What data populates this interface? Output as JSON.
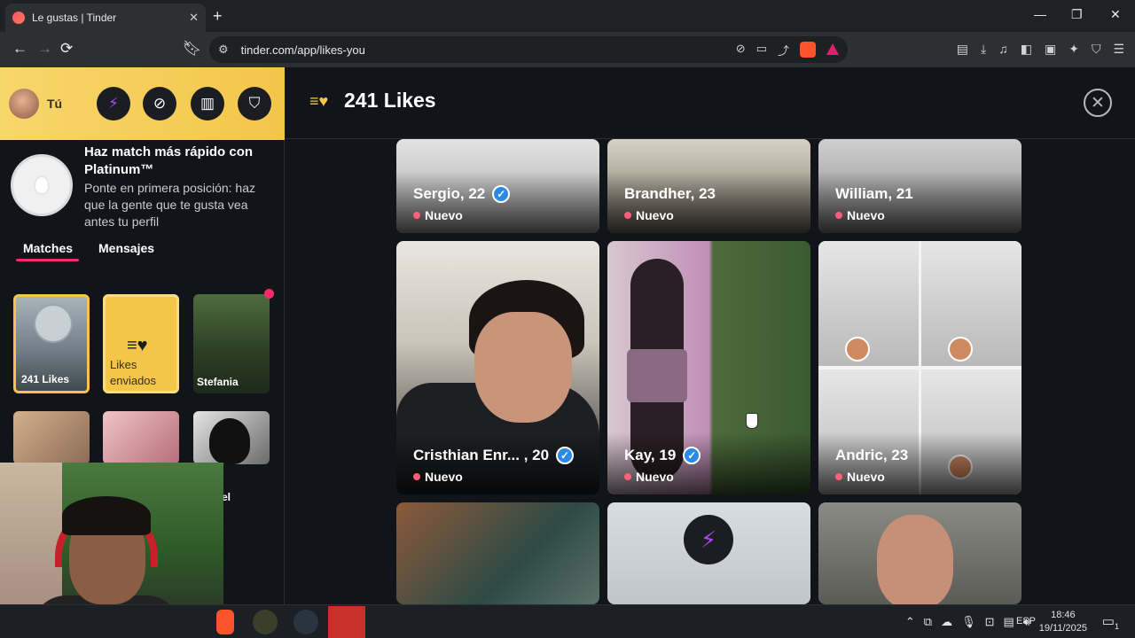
{
  "browser": {
    "tab_title": "Le gustas | Tinder",
    "tab_close": "✕",
    "new_tab": "+",
    "url": "tinder.com/app/likes-you",
    "window_min": "—",
    "window_restore": "❐",
    "window_close": "✕",
    "back": "←",
    "forward": "→",
    "reload": "⟳"
  },
  "sidebar": {
    "me_label": "Tú",
    "promo_title": "Haz match más rápido con Platinum™",
    "promo_desc": "Ponte en primera posición: haz que la gente que te gusta vea antes tu perfil",
    "tab_matches": "Matches",
    "tab_messages": "Mensajes",
    "likes_card_label": "241 Likes",
    "sent_card_label": "Likes enviados",
    "stefania_label": "Stefania",
    "partial_label": "el"
  },
  "main": {
    "title": "241 Likes",
    "close": "✕"
  },
  "cards": [
    {
      "name": "Sergio, 22",
      "status": "Nuevo",
      "verified": true
    },
    {
      "name": "Brandher, 23",
      "status": "Nuevo",
      "verified": false
    },
    {
      "name": "William, 21",
      "status": "Nuevo",
      "verified": false
    },
    {
      "name": "Cristhian Enr... , 20",
      "status": "Nuevo",
      "verified": true
    },
    {
      "name": "Kay, 19",
      "status": "Nuevo",
      "verified": true
    },
    {
      "name": "Andric, 23",
      "status": "Nuevo",
      "verified": false
    }
  ],
  "taskbar": {
    "language": "ESP",
    "time": "18:46",
    "date": "19/11/2025",
    "notification_count": "1"
  },
  "colors": {
    "accent_gold": "#f3c64a",
    "tinder_pink": "#fd2a6b",
    "verified_blue": "#2b8ae8"
  }
}
